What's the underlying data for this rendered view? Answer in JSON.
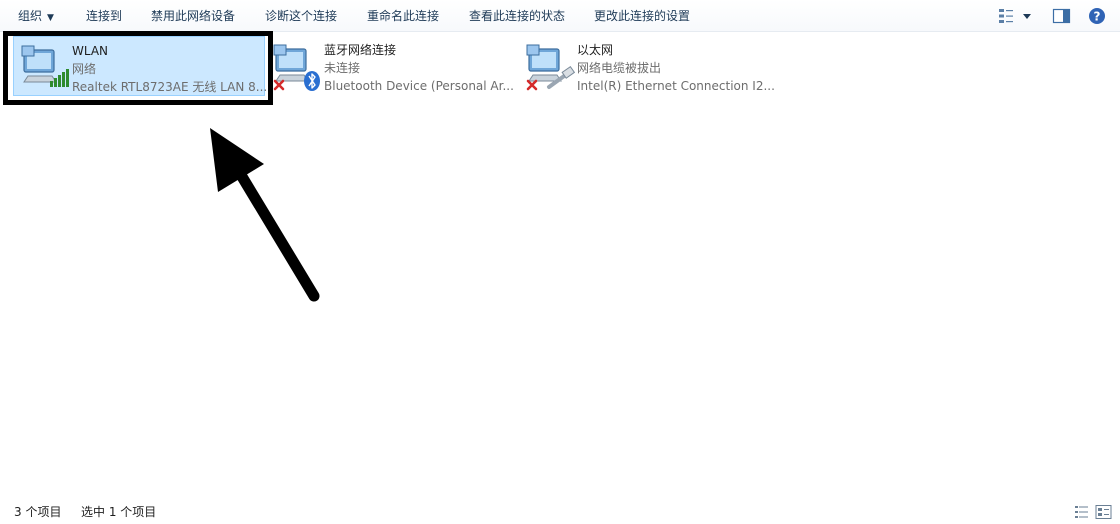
{
  "toolbar": {
    "organize": "组织",
    "connect_to": "连接到",
    "disable_device": "禁用此网络设备",
    "diagnose": "诊断这个连接",
    "rename": "重命名此连接",
    "view_status": "查看此连接的状态",
    "change_settings": "更改此连接的设置"
  },
  "connections": [
    {
      "name": "WLAN",
      "status": "网络",
      "device": "Realtek RTL8723AE 无线 LAN 8...",
      "selected": true,
      "icon": "wlan-adapter-icon"
    },
    {
      "name": "蓝牙网络连接",
      "status": "未连接",
      "device": "Bluetooth Device (Personal Ar...",
      "selected": false,
      "icon": "bluetooth-adapter-icon"
    },
    {
      "name": "以太网",
      "status": "网络电缆被拔出",
      "device": "Intel(R) Ethernet Connection I2...",
      "selected": false,
      "icon": "ethernet-adapter-icon"
    }
  ],
  "statusbar": {
    "item_count": "3 个项目",
    "selected_count": "选中 1 个项目"
  },
  "colors": {
    "selection_bg": "#cce8ff",
    "selection_border": "#99d1ff",
    "toolbar_text": "#1e3a57",
    "secondary_text": "#6d6d6d",
    "annotation": "#000000"
  }
}
